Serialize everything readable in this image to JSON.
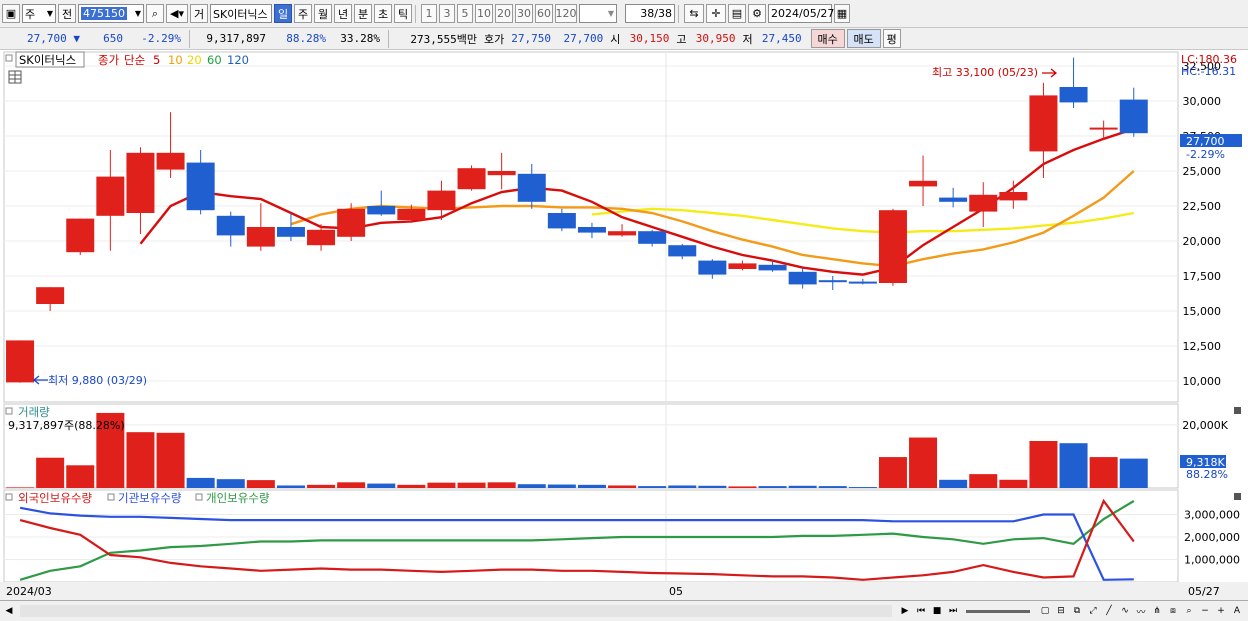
{
  "toolbar1": {
    "type_label": "주",
    "prev_label": "전",
    "code": "475150",
    "broker_label": "거",
    "stock_name": "SK이터닉스",
    "periods": [
      "일",
      "주",
      "월",
      "년",
      "분",
      "초",
      "틱"
    ],
    "selected_period": "일",
    "numbers": [
      "1",
      "3",
      "5",
      "10",
      "20",
      "30",
      "60",
      "120"
    ],
    "count": "38/38",
    "date": "2024/05/27"
  },
  "toolbar2": {
    "price": "27,700",
    "change_arrow": "▼",
    "change": "650",
    "change_pct": "-2.29%",
    "volume": "9,317,897",
    "volume_ratio": "88.28%",
    "turnover": "33.28%",
    "amount": "273,555백만",
    "quote_label": "호가",
    "ask": "27,750",
    "bid": "27,700",
    "open_label": "시",
    "open": "30,150",
    "high_label": "고",
    "high": "30,950",
    "low_label": "저",
    "low": "27,450",
    "buy_label": "매수",
    "sell_label": "매도",
    "eval_label": "평"
  },
  "legend": {
    "stock": "SK이터닉스",
    "close": "종가",
    "ma_type": "단순",
    "ma_periods": [
      "5",
      "10",
      "20",
      "60",
      "120"
    ],
    "ma_colors": [
      "#d00000",
      "#f0a000",
      "#f0e000",
      "#20a040",
      "#2060c0"
    ]
  },
  "annotations": {
    "lc": "LC:180.36",
    "hc": "HC:-16.31",
    "high_label": "최고 33,100 (05/23)",
    "low_label": "최저 9,880 (03/29)",
    "current_price": "27,700",
    "current_pct": "-2.29%",
    "vol_title": "거래량",
    "vol_current": "9,317,897주(88.28%)",
    "vol_tag": "9,318K",
    "vol_pct": "88.28%",
    "holders": [
      "외국인보유수량",
      "기관보유수량",
      "개인보유수량"
    ],
    "x_labels": [
      "2024/03",
      "05",
      "05/27"
    ]
  },
  "colors": {
    "up": "#e0201a",
    "down": "#1f5fcf",
    "ma5": "#d80c0c",
    "ma10": "#f39a18",
    "ma20": "#f4ec18",
    "foreign": "#d51a1a",
    "institution": "#2d52e0",
    "individual": "#2f9a45"
  },
  "chart_data": {
    "type": "candlestick",
    "ylim": [
      8500,
      33500
    ],
    "y_ticks": [
      "32,500",
      "30,000",
      "27,500",
      "25,000",
      "22,500",
      "20,000",
      "17,500",
      "15,000",
      "12,500",
      "10,000"
    ],
    "candles": [
      {
        "o": 9900,
        "c": 12900,
        "h": 12900,
        "l": 9880
      },
      {
        "o": 15500,
        "c": 16700,
        "h": 16700,
        "l": 15000
      },
      {
        "o": 19200,
        "c": 21600,
        "h": 21600,
        "l": 19000
      },
      {
        "o": 21800,
        "c": 24600,
        "h": 26500,
        "l": 19300
      },
      {
        "o": 22000,
        "c": 26300,
        "h": 26700,
        "l": 20500
      },
      {
        "o": 25100,
        "c": 26300,
        "h": 29200,
        "l": 24500
      },
      {
        "o": 25600,
        "c": 22200,
        "h": 26500,
        "l": 21900
      },
      {
        "o": 21800,
        "c": 20400,
        "h": 22100,
        "l": 19600
      },
      {
        "o": 19600,
        "c": 21000,
        "h": 22700,
        "l": 19300
      },
      {
        "o": 21000,
        "c": 20300,
        "h": 22000,
        "l": 20000
      },
      {
        "o": 19700,
        "c": 20800,
        "h": 21200,
        "l": 19300
      },
      {
        "o": 20300,
        "c": 22300,
        "h": 22700,
        "l": 20000
      },
      {
        "o": 22500,
        "c": 21900,
        "h": 23600,
        "l": 21800
      },
      {
        "o": 21500,
        "c": 22300,
        "h": 22600,
        "l": 21300
      },
      {
        "o": 22200,
        "c": 23600,
        "h": 24300,
        "l": 21500
      },
      {
        "o": 23700,
        "c": 25200,
        "h": 25400,
        "l": 23600
      },
      {
        "o": 24700,
        "c": 25000,
        "h": 26300,
        "l": 23700
      },
      {
        "o": 24800,
        "c": 22800,
        "h": 25500,
        "l": 22300
      },
      {
        "o": 22000,
        "c": 20900,
        "h": 22300,
        "l": 20700
      },
      {
        "o": 21000,
        "c": 20600,
        "h": 21300,
        "l": 20200
      },
      {
        "o": 20400,
        "c": 20700,
        "h": 21200,
        "l": 20300
      },
      {
        "o": 20700,
        "c": 19800,
        "h": 20800,
        "l": 19600
      },
      {
        "o": 19700,
        "c": 18900,
        "h": 19800,
        "l": 18700
      },
      {
        "o": 18600,
        "c": 17600,
        "h": 18700,
        "l": 17300
      },
      {
        "o": 18000,
        "c": 18400,
        "h": 18600,
        "l": 17900
      },
      {
        "o": 18300,
        "c": 17900,
        "h": 18600,
        "l": 17800
      },
      {
        "o": 17800,
        "c": 16900,
        "h": 18100,
        "l": 16600
      },
      {
        "o": 17200,
        "c": 17100,
        "h": 17500,
        "l": 16500
      },
      {
        "o": 17100,
        "c": 17000,
        "h": 17300,
        "l": 16900
      },
      {
        "o": 17000,
        "c": 22200,
        "h": 22300,
        "l": 16800
      },
      {
        "o": 23900,
        "c": 24300,
        "h": 26100,
        "l": 22500
      },
      {
        "o": 23100,
        "c": 22800,
        "h": 23800,
        "l": 22400
      },
      {
        "o": 22100,
        "c": 23300,
        "h": 24200,
        "l": 21000
      },
      {
        "o": 22900,
        "c": 23500,
        "h": 24300,
        "l": 22300
      },
      {
        "o": 26400,
        "c": 30400,
        "h": 31300,
        "l": 24500
      },
      {
        "o": 31000,
        "c": 29900,
        "h": 33100,
        "l": 29500
      },
      {
        "o": 28000,
        "c": 28100,
        "h": 28600,
        "l": 27200
      },
      {
        "o": 30100,
        "c": 27700,
        "h": 30950,
        "l": 27450
      }
    ],
    "ma5": [
      null,
      null,
      null,
      null,
      19800,
      22500,
      23500,
      23200,
      23000,
      22000,
      21000,
      20900,
      21300,
      21400,
      21700,
      22700,
      23500,
      23800,
      23600,
      22800,
      21700,
      21000,
      20300,
      19600,
      19000,
      18600,
      18100,
      17800,
      17600,
      18100,
      19700,
      21000,
      22300,
      23800,
      25500,
      26500,
      27300,
      28000
    ],
    "ma10": [
      null,
      null,
      null,
      null,
      null,
      null,
      null,
      null,
      null,
      21200,
      21900,
      22300,
      22500,
      22400,
      22300,
      22400,
      22500,
      22500,
      22400,
      22400,
      22300,
      22000,
      21400,
      20700,
      20100,
      19600,
      19000,
      18700,
      18400,
      18200,
      18700,
      19100,
      19400,
      19900,
      20600,
      21800,
      23100,
      25000
    ],
    "ma20": [
      null,
      null,
      null,
      null,
      null,
      null,
      null,
      null,
      null,
      null,
      null,
      null,
      null,
      null,
      null,
      null,
      null,
      null,
      null,
      21900,
      22100,
      22300,
      22200,
      22000,
      21800,
      21500,
      21200,
      20900,
      20700,
      20600,
      20700,
      20700,
      20800,
      20900,
      21100,
      21300,
      21600,
      22000
    ],
    "volume_ylim": [
      0,
      26000
    ],
    "volume_tick": "20,000K",
    "volume": [
      200,
      9600,
      7200,
      23800,
      17700,
      17500,
      3200,
      2800,
      2500,
      800,
      1000,
      1800,
      1400,
      1000,
      1700,
      1700,
      1800,
      1200,
      1100,
      1000,
      800,
      600,
      800,
      700,
      500,
      600,
      700,
      600,
      300,
      9800,
      16000,
      2600,
      4400,
      2600,
      14900,
      14200,
      9800,
      9318
    ],
    "holding_ylim": [
      0,
      4000000
    ],
    "holding_ticks": [
      "3,000,000",
      "2,000,000",
      "1,000,000"
    ],
    "foreign": [
      2750000,
      2400000,
      2100000,
      1200000,
      1100000,
      850000,
      700000,
      600000,
      500000,
      550000,
      600000,
      550000,
      550000,
      500000,
      450000,
      500000,
      550000,
      550000,
      500000,
      500000,
      450000,
      400000,
      380000,
      350000,
      300000,
      250000,
      250000,
      200000,
      100000,
      200000,
      300000,
      450000,
      750000,
      450000,
      200000,
      250000,
      3600000,
      1800000
    ],
    "institution": [
      3300000,
      3050000,
      2950000,
      2900000,
      2900000,
      2850000,
      2800000,
      2750000,
      2750000,
      2750000,
      2750000,
      2750000,
      2750000,
      2750000,
      2750000,
      2750000,
      2750000,
      2750000,
      2750000,
      2750000,
      2750000,
      2750000,
      2750000,
      2750000,
      2750000,
      2750000,
      2750000,
      2750000,
      2750000,
      2700000,
      2700000,
      2700000,
      2700000,
      2700000,
      3000000,
      3000000,
      100000,
      120000
    ],
    "individual": [
      100000,
      500000,
      700000,
      1300000,
      1400000,
      1550000,
      1600000,
      1700000,
      1800000,
      1800000,
      1850000,
      1850000,
      1850000,
      1850000,
      1850000,
      1850000,
      1850000,
      1850000,
      1900000,
      1950000,
      2000000,
      2000000,
      2000000,
      2000000,
      2000000,
      2000000,
      2050000,
      2050000,
      2100000,
      2150000,
      2000000,
      1900000,
      1700000,
      1900000,
      1950000,
      1700000,
      2800000,
      3600000
    ]
  }
}
